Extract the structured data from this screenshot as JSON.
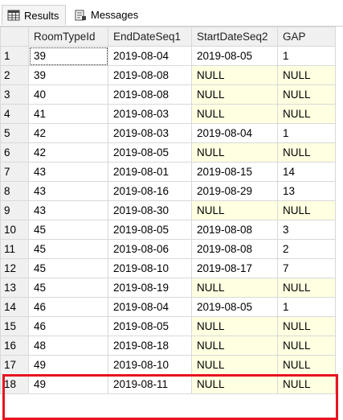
{
  "tabs": [
    {
      "label": "Results",
      "icon": "grid-icon",
      "active": true
    },
    {
      "label": "Messages",
      "icon": "messages-icon",
      "active": false
    }
  ],
  "columns": [
    "RoomTypeId",
    "EndDateSeq1",
    "StartDateSeq2",
    "GAP"
  ],
  "rows": [
    [
      "1",
      "39",
      "2019-08-04",
      "2019-08-05",
      "1"
    ],
    [
      "2",
      "39",
      "2019-08-08",
      "NULL",
      "NULL"
    ],
    [
      "3",
      "40",
      "2019-08-08",
      "NULL",
      "NULL"
    ],
    [
      "4",
      "41",
      "2019-08-03",
      "NULL",
      "NULL"
    ],
    [
      "5",
      "42",
      "2019-08-03",
      "2019-08-04",
      "1"
    ],
    [
      "6",
      "42",
      "2019-08-05",
      "NULL",
      "NULL"
    ],
    [
      "7",
      "43",
      "2019-08-01",
      "2019-08-15",
      "14"
    ],
    [
      "8",
      "43",
      "2019-08-16",
      "2019-08-29",
      "13"
    ],
    [
      "9",
      "43",
      "2019-08-30",
      "NULL",
      "NULL"
    ],
    [
      "10",
      "45",
      "2019-08-05",
      "2019-08-08",
      "3"
    ],
    [
      "11",
      "45",
      "2019-08-06",
      "2019-08-08",
      "2"
    ],
    [
      "12",
      "45",
      "2019-08-10",
      "2019-08-17",
      "7"
    ],
    [
      "13",
      "45",
      "2019-08-19",
      "NULL",
      "NULL"
    ],
    [
      "14",
      "46",
      "2019-08-04",
      "2019-08-05",
      "1"
    ],
    [
      "15",
      "46",
      "2019-08-05",
      "NULL",
      "NULL"
    ],
    [
      "16",
      "48",
      "2019-08-18",
      "NULL",
      "NULL"
    ],
    [
      "17",
      "49",
      "2019-08-10",
      "NULL",
      "NULL"
    ],
    [
      "18",
      "49",
      "2019-08-11",
      "NULL",
      "NULL"
    ]
  ],
  "highlighted_rows": [
    "17",
    "18"
  ],
  "colors": {
    "null_cell": "#ffffe1",
    "highlight": "#e8141f",
    "header": "#f0f0f0"
  }
}
